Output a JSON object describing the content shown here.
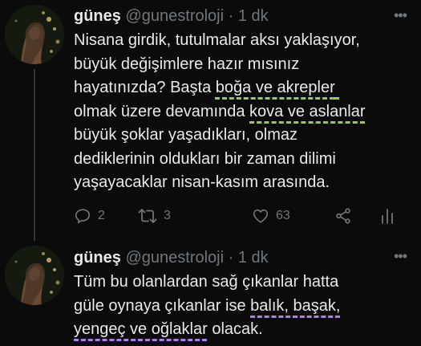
{
  "tweets": [
    {
      "author": "güneş",
      "handle": "@gunestroloji",
      "separator": "·",
      "time": "1 dk",
      "more": "•••",
      "lines": [
        [
          "Nisana girdik, tutulmalar aksı yaklaşıyor,"
        ],
        [
          "büyük değişimlere hazır mısınız"
        ],
        [
          "hayatınızda? Başta ",
          "boğa ve akrepler",
          " "
        ],
        [
          "olmak üzere devamında ",
          "kova ve aslanlar"
        ],
        [
          "büyük şoklar yaşadıkları, olmaz"
        ],
        [
          "dediklerinin oldukları bir zaman dilimi"
        ],
        [
          "yaşayacaklar nisan-kasım arasında."
        ]
      ],
      "actions": {
        "reply_icon": "reply-icon",
        "reply_count": "2",
        "retweet_icon": "retweet-icon",
        "retweet_count": "3",
        "like_icon": "heart-icon",
        "like_count": "63",
        "share_icon": "share-icon",
        "stats_icon": "analytics-icon"
      }
    },
    {
      "author": "güneş",
      "handle": "@gunestroloji",
      "separator": "·",
      "time": "1 dk",
      "more": "•••",
      "lines": [
        [
          "Tüm bu olanlardan sağ çıkanlar hatta"
        ],
        [
          "güle oynaya çıkanlar ise ",
          "balık, başak,"
        ],
        [
          "",
          "yengeç ve oğlaklar",
          " olacak."
        ]
      ]
    }
  ],
  "colors": {
    "background": "#0b0b0b",
    "text": "#e7e9ea",
    "muted": "#71767b",
    "underline_green": "#8fd14f",
    "underline_purple": "#b37bf0"
  }
}
